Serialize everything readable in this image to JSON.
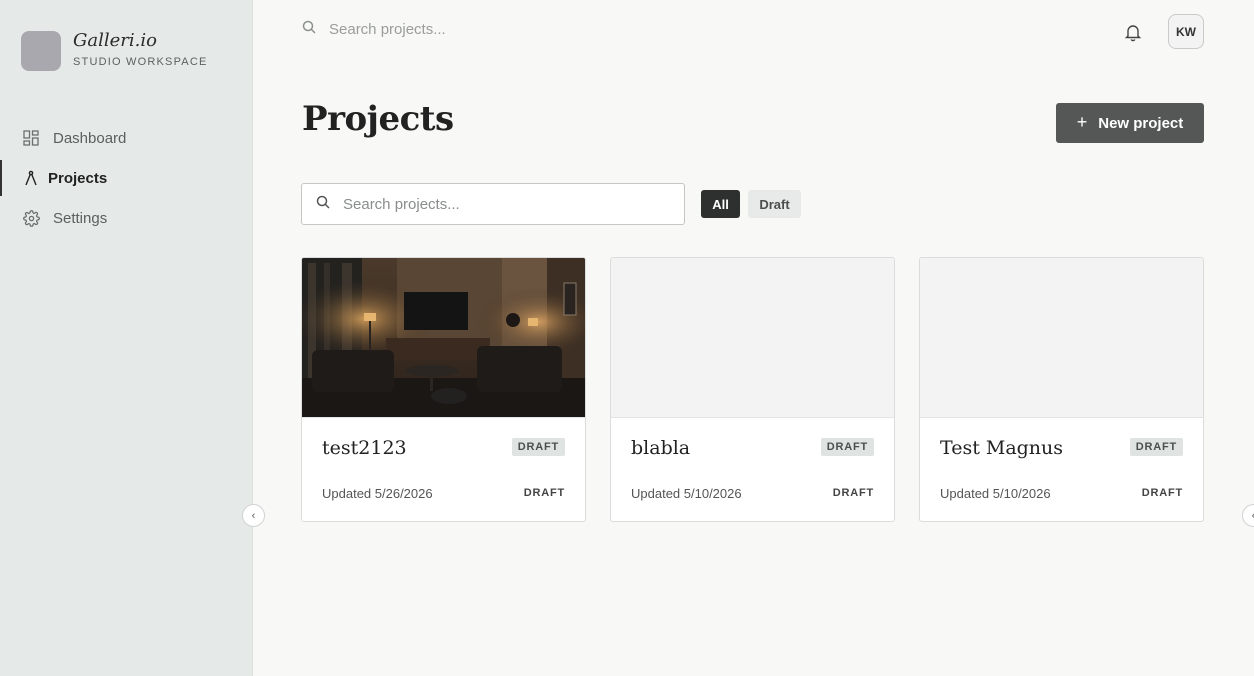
{
  "brand": {
    "name": "Galleri.io",
    "subtitle": "STUDIO WORKSPACE"
  },
  "sidebar": {
    "items": [
      {
        "label": "Dashboard",
        "icon": "grid-icon",
        "active": false
      },
      {
        "label": "Projects",
        "icon": "compass-icon",
        "active": true
      },
      {
        "label": "Settings",
        "icon": "gear-icon",
        "active": false
      }
    ]
  },
  "topbar": {
    "search_placeholder": "Search projects...",
    "avatar_initials": "KW"
  },
  "page": {
    "title": "Projects",
    "new_button_label": "New project"
  },
  "filters": {
    "search_placeholder": "Search projects...",
    "chips": [
      {
        "label": "All",
        "selected": true
      },
      {
        "label": "Draft",
        "selected": false
      }
    ]
  },
  "projects": [
    {
      "title": "test2123",
      "badge": "DRAFT",
      "updated": "Updated 5/26/2026",
      "status": "DRAFT",
      "has_image": true
    },
    {
      "title": "blabla",
      "badge": "DRAFT",
      "updated": "Updated 5/10/2026",
      "status": "DRAFT",
      "has_image": false
    },
    {
      "title": "Test Magnus",
      "badge": "DRAFT",
      "updated": "Updated 5/10/2026",
      "status": "DRAFT",
      "has_image": false
    }
  ],
  "colors": {
    "sidebar_bg": "#e5e9e8",
    "primary_button": "#555656",
    "chip_selected": "#2e3030"
  }
}
